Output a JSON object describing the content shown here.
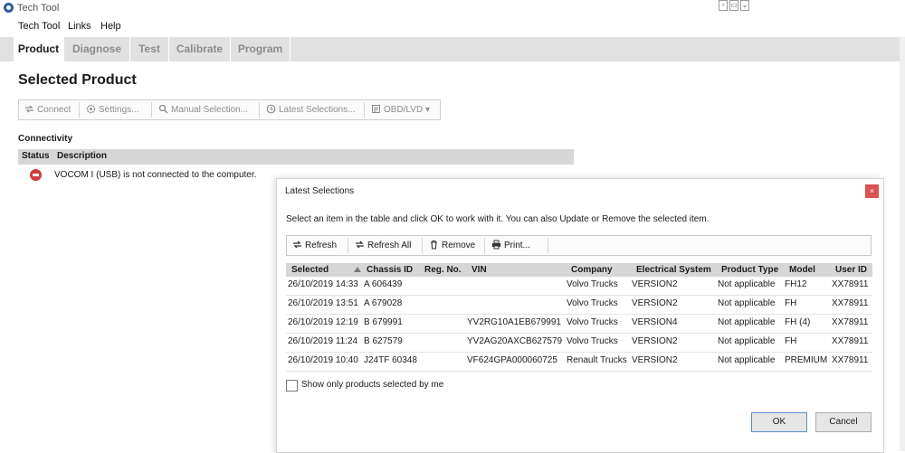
{
  "window": {
    "title": "Tech Tool"
  },
  "menu": {
    "items": [
      "Tech Tool",
      "Links",
      "Help"
    ]
  },
  "tabs": [
    {
      "label": "Product",
      "active": true
    },
    {
      "label": "Diagnose",
      "active": false
    },
    {
      "label": "Test",
      "active": false
    },
    {
      "label": "Calibrate",
      "active": false
    },
    {
      "label": "Program",
      "active": false
    }
  ],
  "page": {
    "title": "Selected Product"
  },
  "toolbar": {
    "connect": "Connect",
    "settings": "Settings...",
    "manual_selection": "Manual Selection...",
    "latest_selections": "Latest Selections...",
    "obd_lvd": "OBD/LVD"
  },
  "connectivity": {
    "label": "Connectivity",
    "col_status": "Status",
    "col_description": "Description",
    "row_description": "VOCOM I (USB) is not connected to the computer."
  },
  "dialog": {
    "title": "Latest Selections",
    "close": "×",
    "instructions": "Select an item in the table and click OK to work with it. You can also Update or Remove the selected item.",
    "toolbar": {
      "refresh": "Refresh",
      "refresh_all": "Refresh All",
      "remove": "Remove",
      "print": "Print..."
    },
    "columns": [
      "Selected",
      "Chassis ID",
      "Reg. No.",
      "VIN",
      "Company",
      "Electrical System",
      "Product Type",
      "Model",
      "User ID"
    ],
    "rows": [
      [
        "26/10/2019 14:33",
        "A 606439",
        "",
        "",
        "Volvo Trucks",
        "VERSION2",
        "Not applicable",
        "FH12",
        "XX78911"
      ],
      [
        "26/10/2019 13:51",
        "A 679028",
        "",
        "",
        "Volvo Trucks",
        "VERSION2",
        "Not applicable",
        "FH",
        "XX78911"
      ],
      [
        "26/10/2019 12:19",
        "B 679991",
        "",
        "YV2RG10A1EB679991",
        "Volvo Trucks",
        "VERSION4",
        "Not applicable",
        "FH (4)",
        "XX78911"
      ],
      [
        "26/10/2019 11:24",
        "B 627579",
        "",
        "YV2AG20AXCB627579",
        "Volvo Trucks",
        "VERSION2",
        "Not applicable",
        "FH",
        "XX78911"
      ],
      [
        "26/10/2019 10:40",
        "J24TF 60348",
        "",
        "VF624GPA000060725",
        "Renault Trucks",
        "VERSION2",
        "Not applicable",
        "PREMIUM",
        "XX78911"
      ]
    ],
    "show_only_mine": "Show only products selected by me",
    "ok": "OK",
    "cancel": "Cancel"
  },
  "colors": {
    "tab_bar": "#e1e1e1",
    "header": "#d6d6d6",
    "error": "#d23b3b",
    "close": "#d9534f"
  },
  "icons": [
    "app-icon",
    "connect-icon",
    "settings-icon",
    "search-icon",
    "clock-icon",
    "obd-icon",
    "error-icon",
    "refresh-icon",
    "trash-icon",
    "printer-icon",
    "sort-ascending-icon"
  ]
}
